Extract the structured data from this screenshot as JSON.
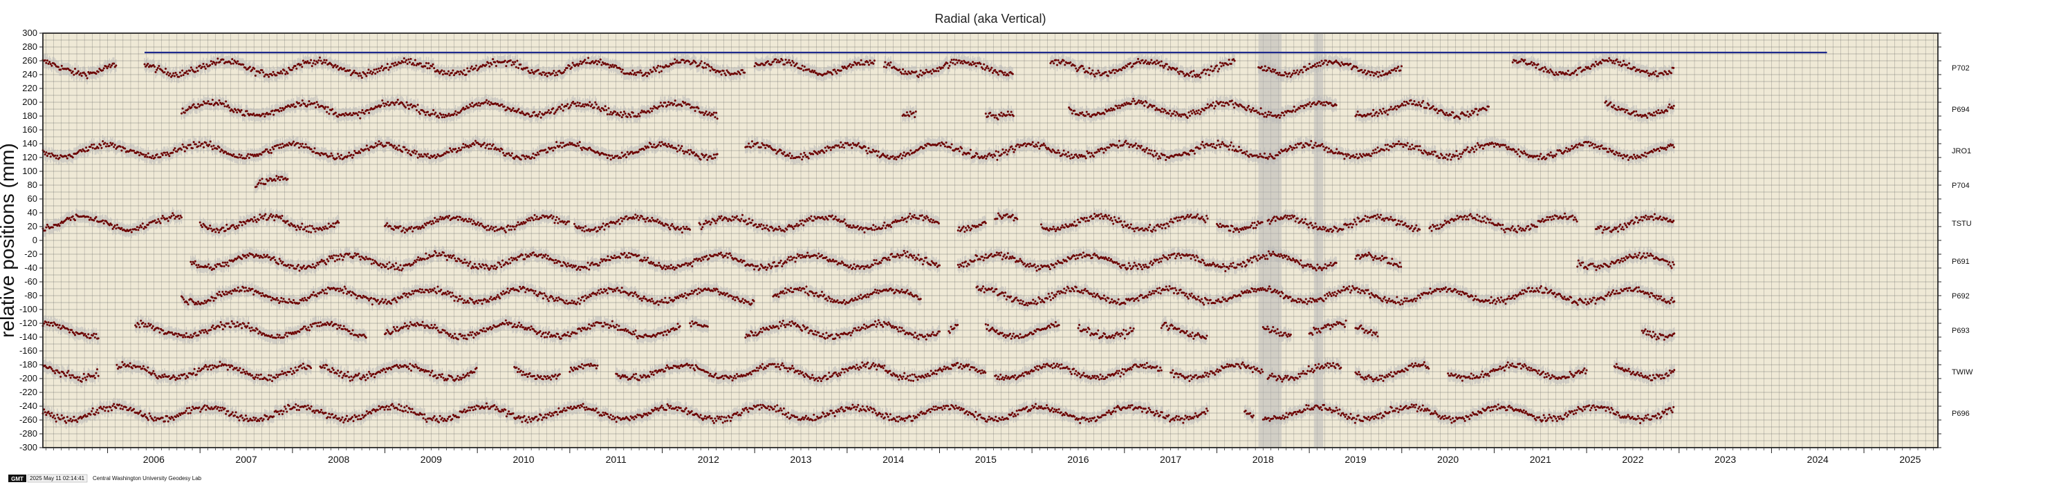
{
  "chart_data": {
    "type": "scatter",
    "title": "Radial (aka Vertical)",
    "ylabel": "relative positions (mm)",
    "xlabel": "",
    "xlim": [
      2005.3,
      2025.8
    ],
    "ylim": [
      -300,
      300
    ],
    "ytick_step": 20,
    "xticks": [
      "2006",
      "2007",
      "2008",
      "2009",
      "2010",
      "2011",
      "2012",
      "2013",
      "2014",
      "2015",
      "2016",
      "2017",
      "2018",
      "2019",
      "2020",
      "2021",
      "2022",
      "2023",
      "2024",
      "2025"
    ],
    "grid": true,
    "colors": {
      "background": "#efe9d6",
      "points": "#6b0000",
      "errorbars": "#b8b8b8",
      "reference_line": "#1e2a8c",
      "grid": "#5a5a5a"
    },
    "reference_line": {
      "y": 272,
      "x_start": 2006.4,
      "x_end": 2024.6
    },
    "series": [
      {
        "name": "P702",
        "offset": 250,
        "segments": [
          [
            2005.3,
            2006.1
          ],
          [
            2006.4,
            2012.9
          ],
          [
            2013.0,
            2014.3
          ],
          [
            2014.4,
            2015.8
          ],
          [
            2016.2,
            2018.2
          ],
          [
            2018.45,
            2020.0
          ],
          [
            2021.2,
            2022.95
          ]
        ]
      },
      {
        "name": "P694",
        "offset": 190,
        "segments": [
          [
            2006.8,
            2012.6
          ],
          [
            2014.6,
            2014.75
          ],
          [
            2015.5,
            2015.8
          ],
          [
            2016.4,
            2019.3
          ],
          [
            2019.5,
            2020.95
          ],
          [
            2022.2,
            2022.95
          ]
        ]
      },
      {
        "name": "JRO1",
        "offset": 130,
        "segments": [
          [
            2005.3,
            2012.6
          ],
          [
            2012.9,
            2022.95
          ]
        ]
      },
      {
        "name": "P704",
        "offset": 80,
        "segments": [
          [
            2007.6,
            2007.95
          ]
        ]
      },
      {
        "name": "TSTU",
        "offset": 25,
        "segments": [
          [
            2005.3,
            2006.8
          ],
          [
            2007.0,
            2008.5
          ],
          [
            2009.0,
            2011.0
          ],
          [
            2011.05,
            2012.0
          ],
          [
            2012.0,
            2012.3
          ],
          [
            2012.4,
            2015.0
          ],
          [
            2015.2,
            2015.5
          ],
          [
            2015.6,
            2015.85
          ],
          [
            2016.1,
            2017.9
          ],
          [
            2018.0,
            2018.5
          ],
          [
            2018.55,
            2020.2
          ],
          [
            2020.3,
            2021.9
          ],
          [
            2022.1,
            2022.95
          ]
        ]
      },
      {
        "name": "P691",
        "offset": -30,
        "segments": [
          [
            2006.9,
            2015.0
          ],
          [
            2015.2,
            2019.3
          ],
          [
            2019.5,
            2020.0
          ],
          [
            2021.9,
            2022.95
          ]
        ]
      },
      {
        "name": "P692",
        "offset": -80,
        "segments": [
          [
            2006.8,
            2013.0
          ],
          [
            2013.2,
            2014.8
          ],
          [
            2015.4,
            2022.95
          ]
        ]
      },
      {
        "name": "P693",
        "offset": -130,
        "segments": [
          [
            2005.3,
            2005.9
          ],
          [
            2006.3,
            2008.8
          ],
          [
            2009.0,
            2012.2
          ],
          [
            2012.3,
            2012.5
          ],
          [
            2012.9,
            2015.0
          ],
          [
            2015.1,
            2015.2
          ],
          [
            2015.5,
            2016.3
          ],
          [
            2016.5,
            2017.1
          ],
          [
            2017.4,
            2017.9
          ],
          [
            2018.5,
            2018.8
          ],
          [
            2019.0,
            2019.4
          ],
          [
            2019.5,
            2019.75
          ],
          [
            2022.6,
            2022.95
          ]
        ]
      },
      {
        "name": "TWIW",
        "offset": -190,
        "segments": [
          [
            2005.3,
            2005.9
          ],
          [
            2006.1,
            2008.2
          ],
          [
            2008.3,
            2010.0
          ],
          [
            2010.4,
            2010.9
          ],
          [
            2011.0,
            2011.3
          ],
          [
            2011.5,
            2015.5
          ],
          [
            2015.6,
            2017.4
          ],
          [
            2017.5,
            2018.5
          ],
          [
            2018.55,
            2019.35
          ],
          [
            2019.5,
            2020.3
          ],
          [
            2020.5,
            2022.0
          ],
          [
            2022.3,
            2022.95
          ]
        ]
      },
      {
        "name": "P696",
        "offset": -250,
        "segments": [
          [
            2005.3,
            2017.9
          ],
          [
            2018.3,
            2018.4
          ],
          [
            2018.5,
            2022.95
          ]
        ]
      }
    ],
    "gap_bands": [
      [
        2018.45,
        2018.7
      ],
      [
        2019.05,
        2019.15
      ]
    ]
  },
  "footer": {
    "logo": "GMT",
    "timestamp": "2025 May 11 02:14:41",
    "credit": "Central Washington University Geodesy Lab"
  }
}
